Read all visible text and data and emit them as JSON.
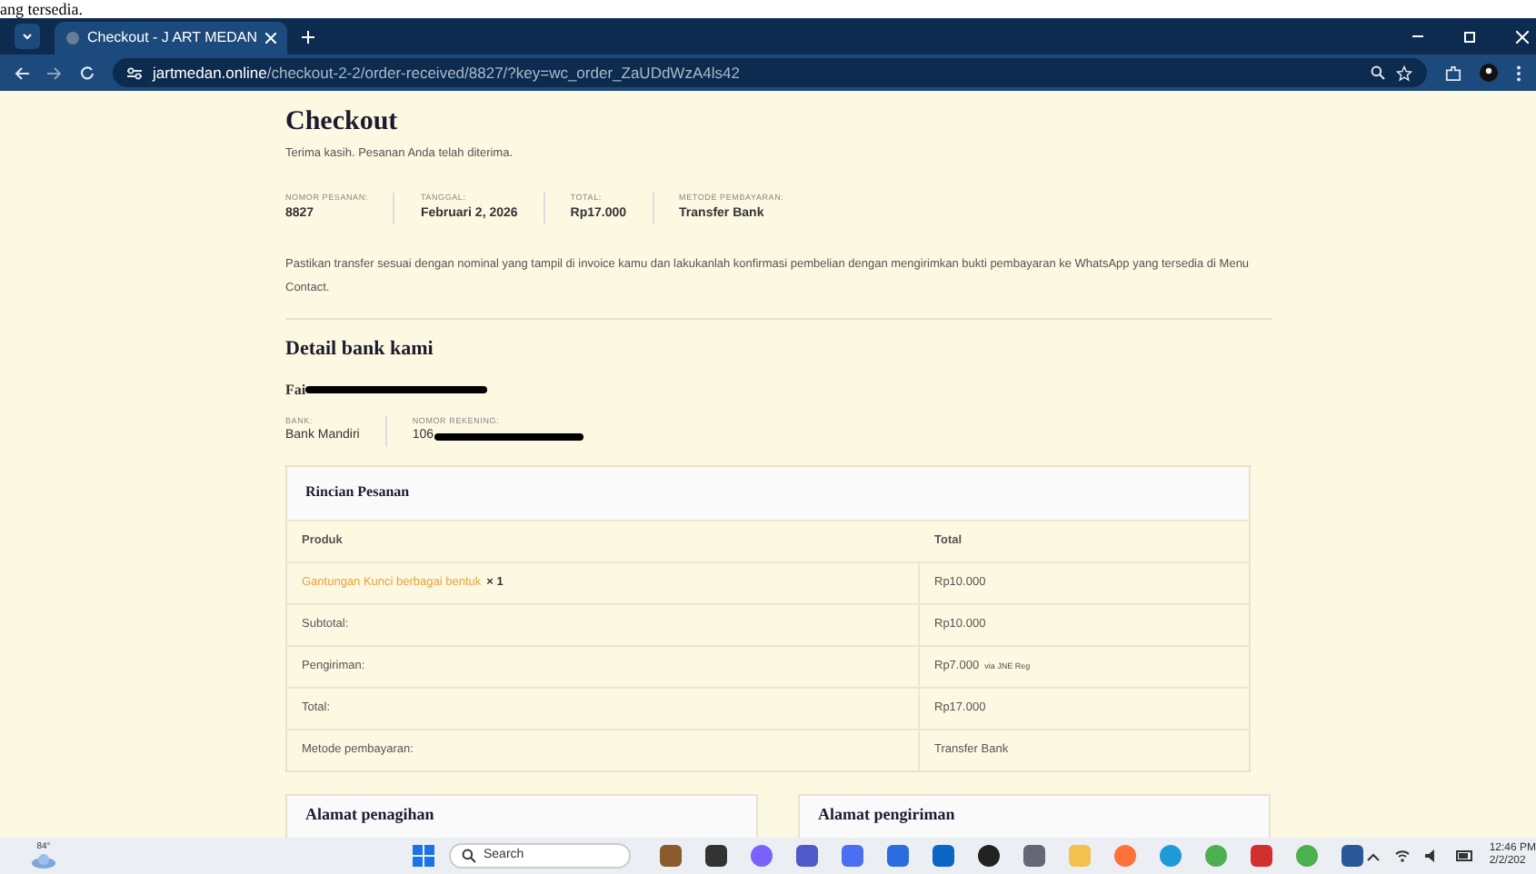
{
  "above_window": {
    "text": "ang tersedia."
  },
  "browser": {
    "tab": {
      "title": "Checkout - J ART MEDAN",
      "selected": true
    },
    "url": {
      "host": "jartmedan.online",
      "path": "/checkout-2-2/order-received/8827/?key=wc_order_ZaUDdWzA4ls42"
    }
  },
  "page": {
    "title": "Checkout",
    "thanks": "Terima kasih. Pesanan Anda telah diterima.",
    "overview": [
      {
        "label": "NOMOR PESANAN:",
        "value": "8827"
      },
      {
        "label": "TANGGAL:",
        "value": "Februari 2, 2026"
      },
      {
        "label": "TOTAL:",
        "value": "Rp17.000"
      },
      {
        "label": "METODE PEMBAYARAN:",
        "value": "Transfer Bank"
      }
    ],
    "instructions": "Pastikan transfer sesuai dengan nominal yang tampil di invoice kamu dan lakukanlah konfirmasi pembelian dengan mengirimkan bukti pembayaran ke WhatsApp yang tersedia di Menu Contact.",
    "bank_heading": "Detail bank kami",
    "account_name": {
      "text": "Fai",
      "redacted": true
    },
    "bank_details": [
      {
        "label": "BANK:",
        "value": "Bank Mandiri",
        "redacted": false
      },
      {
        "label": "NOMOR REKENING:",
        "value": "106",
        "redacted": true
      }
    ],
    "order": {
      "title": "Rincian Pesanan",
      "columns": [
        "Produk",
        "Total"
      ],
      "rows": [
        {
          "kind": "product",
          "label": "Gantungan Kunci berbagai bentuk",
          "qty": "× 1",
          "value": "Rp10.000"
        },
        {
          "kind": "line",
          "label": "Subtotal:",
          "value": "Rp10.000"
        },
        {
          "kind": "line",
          "label": "Pengiriman:",
          "value": "Rp7.000",
          "note": "via JNE Reg"
        },
        {
          "kind": "line",
          "label": "Total:",
          "value": "Rp17.000"
        },
        {
          "kind": "line",
          "label": "Metode pembayaran:",
          "value": "Transfer Bank"
        }
      ]
    },
    "addresses": [
      "Alamat penagihan",
      "Alamat pengiriman"
    ]
  },
  "taskbar": {
    "weather": "84°",
    "search_placeholder": "Search",
    "time": "12:46 PM",
    "date": "2/2/202"
  }
}
